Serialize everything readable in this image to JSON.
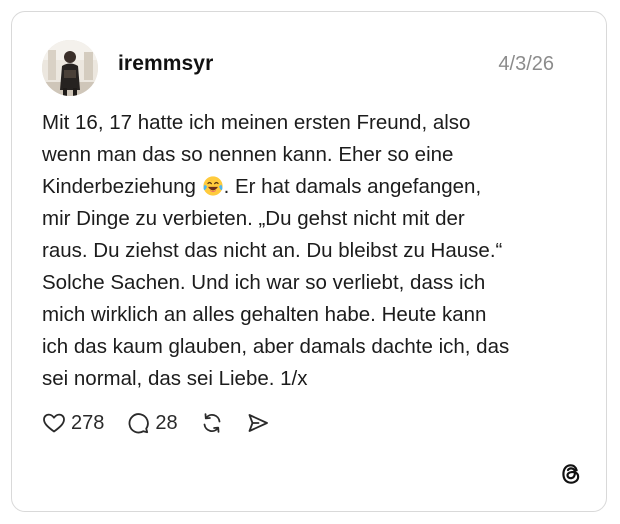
{
  "post": {
    "username": "iremmsyr",
    "date": "4/3/26",
    "text_lines": [
      "Mit 16, 17 hatte ich meinen ersten Freund, also",
      "wenn man das so nennen kann. Eher so eine",
      "Kinderbeziehung",
      ". Er hat damals angefangen,",
      "mir Dinge zu verbieten. „Du gehst nicht mit der",
      "raus. Du ziehst das nicht an. Du bleibst zu Hause.“",
      "Solche Sachen. Und ich war so verliebt, dass ich",
      "mich wirklich an alles gehalten habe. Heute kann",
      "ich das kaum glauben, aber damals dachte ich, das",
      "sei normal, das sei Liebe. 1/x"
    ],
    "emoji": "face-with-tears-of-joy-icon"
  },
  "actions": {
    "likes": "278",
    "replies": "28",
    "like_icon": "heart-icon",
    "reply_icon": "comment-icon",
    "repost_icon": "repost-icon",
    "share_icon": "send-icon"
  },
  "branding": {
    "logo": "threads-logo-icon"
  },
  "colors": {
    "text": "#1c1c1c",
    "muted": "#8c8c8c",
    "border": "#d9d9d9"
  }
}
